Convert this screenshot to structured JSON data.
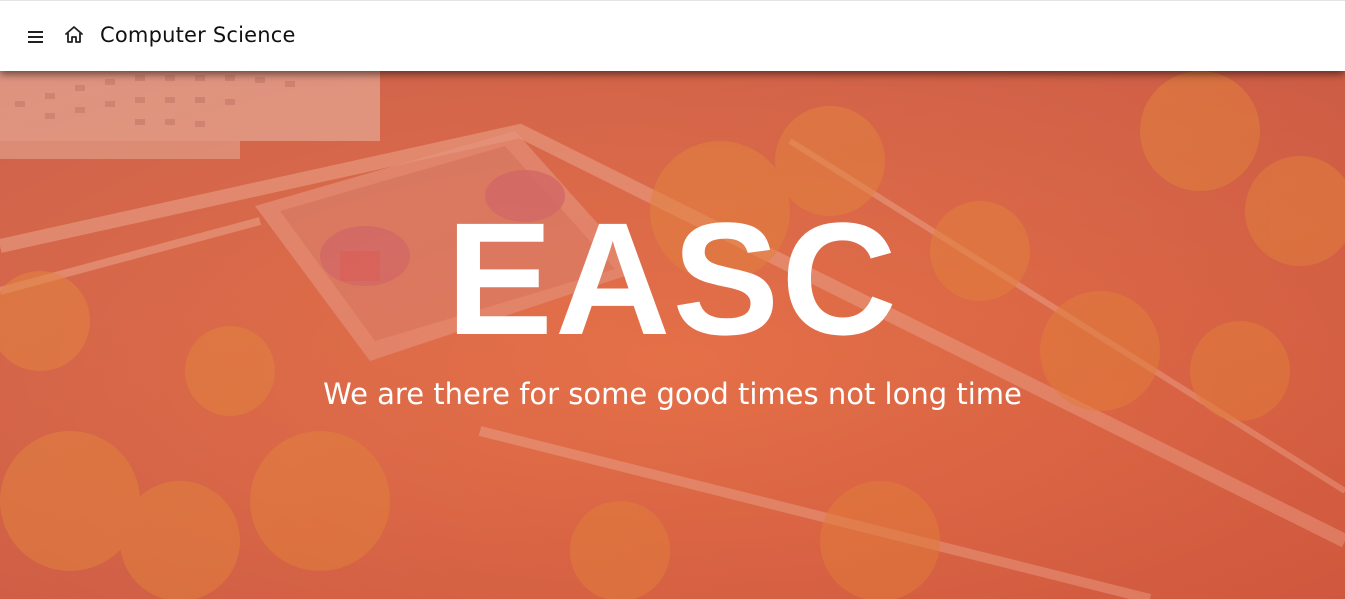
{
  "header": {
    "title": "Computer Science",
    "menu_icon": "hamburger-menu-icon",
    "home_icon": "home-icon"
  },
  "hero": {
    "title": "EASC",
    "subtitle": "We are there for some good times not long time",
    "background": "aerial-campus-photo",
    "overlay_color": "#e4683f"
  }
}
